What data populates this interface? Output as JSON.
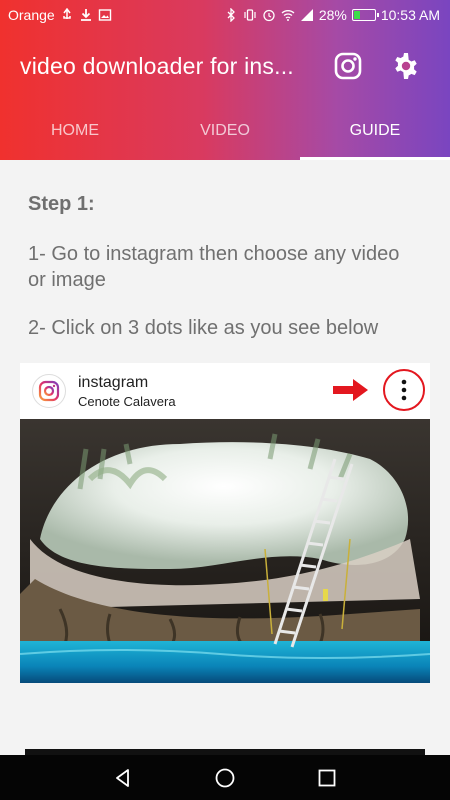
{
  "status_bar": {
    "carrier": "Orange",
    "battery_percent": "28%",
    "time": "10:53 AM",
    "battery_level": 0.28
  },
  "toolbar": {
    "title": "video downloader for ins...",
    "instagram_icon": "instagram-icon",
    "settings_icon": "gear-icon"
  },
  "tabs": [
    {
      "label": "HOME",
      "active": false
    },
    {
      "label": "VIDEO",
      "active": false
    },
    {
      "label": "GUIDE",
      "active": true
    }
  ],
  "guide": {
    "step_title": "Step 1:",
    "instruction_1": "1- Go to instagram then choose any video or image",
    "instruction_2": "2- Click on 3 dots like as you see below"
  },
  "post": {
    "username": "instagram",
    "location": "Cenote Calavera",
    "more_icon": "more-vertical-icon"
  },
  "colors": {
    "gradient_start": "#f0312e",
    "gradient_end": "#7a45c0",
    "highlight_red": "#e3171f",
    "text_gray": "#707070"
  },
  "nav": {
    "back_icon": "back-icon",
    "home_icon": "home-circle-icon",
    "recents_icon": "recents-icon"
  }
}
